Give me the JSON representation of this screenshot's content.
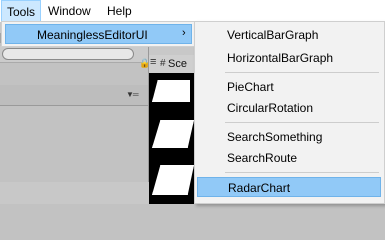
{
  "menubar": {
    "items": [
      {
        "label": "Tools"
      },
      {
        "label": "Window"
      },
      {
        "label": "Help"
      }
    ]
  },
  "tools_menu": {
    "item": {
      "label": "MeaninglessEditorUI",
      "arrow": "›"
    }
  },
  "submenu": {
    "items": [
      {
        "label": "VerticalBarGraph"
      },
      {
        "label": "HorizontalBarGraph"
      },
      {
        "label": "PieChart"
      },
      {
        "label": "CircularRotation"
      },
      {
        "label": "SearchSomething"
      },
      {
        "label": "SearchRoute"
      },
      {
        "label": "RadarChart",
        "selected": true
      }
    ]
  },
  "scene": {
    "tab_label": "Sce",
    "icons": [
      "lock-icon",
      "hamburger-icon",
      "dropdown-icon",
      "scene-icon"
    ]
  },
  "colors": {
    "highlight": "#91c9f7",
    "highlight_border": "#6fb3ea",
    "menu_bg": "#f2f2f2",
    "active_menubar": "#cce8ff"
  }
}
